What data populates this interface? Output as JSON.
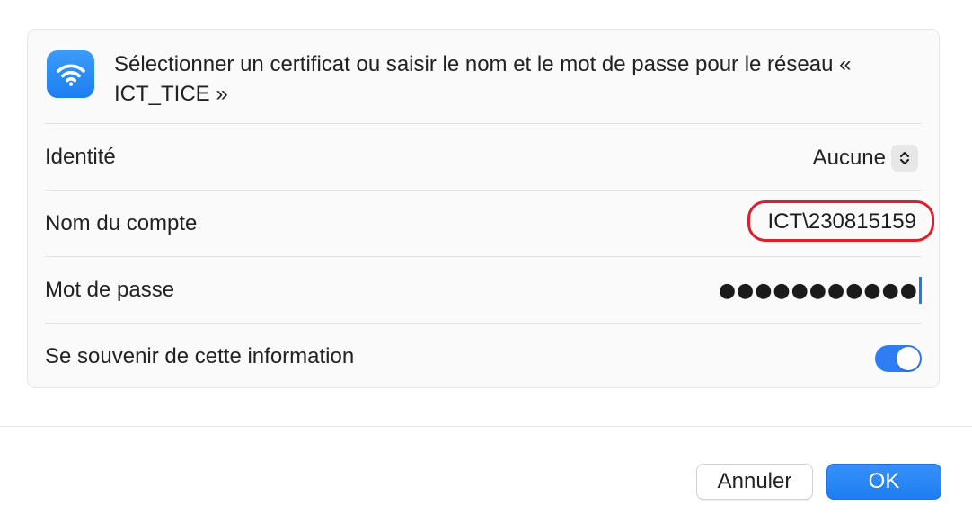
{
  "header": {
    "icon": "wifi-icon",
    "message": "Sélectionner un certificat ou saisir le nom et le mot de passe pour le réseau « ICT_TICE »"
  },
  "identity": {
    "label": "Identité",
    "value": "Aucune"
  },
  "account": {
    "label": "Nom du compte",
    "value": "ICT\\230815159"
  },
  "password": {
    "label": "Mot de passe",
    "masked": "●●●●●●●●●●●"
  },
  "remember": {
    "label": "Se souvenir de cette information",
    "enabled": true
  },
  "buttons": {
    "cancel": "Annuler",
    "ok": "OK"
  },
  "colors": {
    "accent": "#1d7ef2",
    "highlight": "#e01d2a"
  }
}
